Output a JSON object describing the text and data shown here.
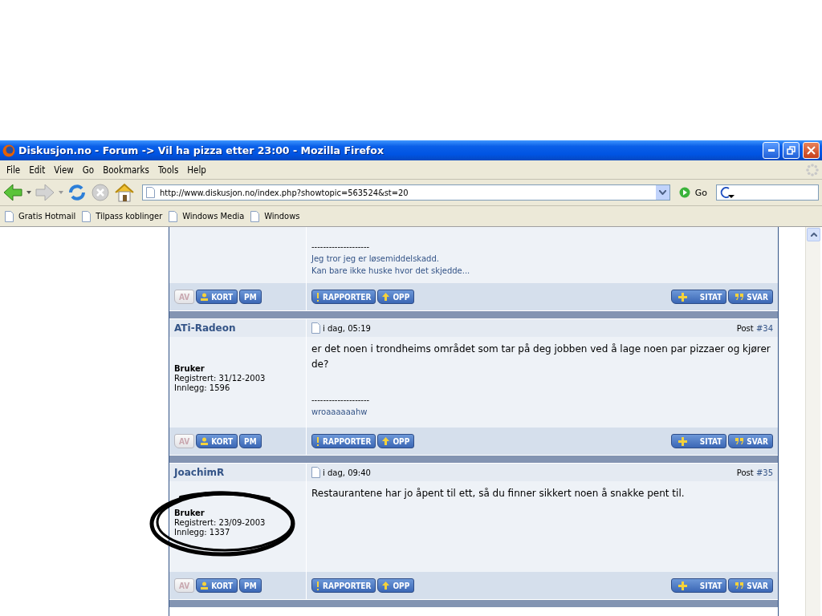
{
  "window": {
    "title": "Diskusjon.no - Forum -> Vil ha pizza etter 23:00 - Mozilla Firefox"
  },
  "menu": [
    "File",
    "Edit",
    "View",
    "Go",
    "Bookmarks",
    "Tools",
    "Help"
  ],
  "navigation": {
    "url": "http://www.diskusjon.no/index.php?showtopic=563524&st=20",
    "go_label": "Go"
  },
  "bookmarks": [
    "Gratis Hotmail",
    "Tilpass koblinger",
    "Windows Media",
    "Windows"
  ],
  "posts": [
    {
      "partial": true,
      "signature": [
        "--------------------",
        "Jeg tror jeg er løsemiddelskadd.",
        "Kan bare ikke huske hvor det skjedde..."
      ],
      "buttons_left": [
        {
          "label": "AV",
          "disabled": true
        },
        {
          "label": "KORT",
          "disabled": false
        },
        {
          "label": "PM",
          "disabled": false
        }
      ],
      "buttons_mid": [
        {
          "label": "RAPPORTER"
        },
        {
          "label": "OPP"
        }
      ],
      "buttons_right": [
        {
          "label": "SITAT"
        },
        {
          "label": "SVAR"
        }
      ]
    },
    {
      "partial": false,
      "author": "ATi-Radeon",
      "date": "i dag, 05:19",
      "post_label": "Post",
      "post_number": "#34",
      "rank": "Bruker",
      "registered": "Registrert: 31/12-2003",
      "count": "Innlegg: 1596",
      "circled": false,
      "body": "er det noen i trondheims området som tar på deg jobben ved å lage noen par pizzaer og kjører de?",
      "signature": [
        "--------------------",
        "wroaaaaaahw"
      ],
      "buttons_left": [
        {
          "label": "AV",
          "disabled": true
        },
        {
          "label": "KORT",
          "disabled": false
        },
        {
          "label": "PM",
          "disabled": false
        }
      ],
      "buttons_mid": [
        {
          "label": "RAPPORTER"
        },
        {
          "label": "OPP"
        }
      ],
      "buttons_right": [
        {
          "label": "SITAT"
        },
        {
          "label": "SVAR"
        }
      ]
    },
    {
      "partial": false,
      "author": "JoachimR",
      "date": "i dag, 09:40",
      "post_label": "Post",
      "post_number": "#35",
      "rank": "Bruker",
      "registered": "Registrert: 23/09-2003",
      "count": "Innlegg: 1337",
      "circled": true,
      "body": "Restaurantene har jo åpent til ett, så du finner sikkert noen å snakke pent til.",
      "buttons_left": [
        {
          "label": "AV",
          "disabled": true
        },
        {
          "label": "KORT",
          "disabled": false
        },
        {
          "label": "PM",
          "disabled": false
        }
      ],
      "buttons_mid": [
        {
          "label": "RAPPORTER"
        },
        {
          "label": "OPP"
        }
      ],
      "buttons_right": [
        {
          "label": "SITAT"
        },
        {
          "label": "SVAR"
        }
      ]
    }
  ]
}
